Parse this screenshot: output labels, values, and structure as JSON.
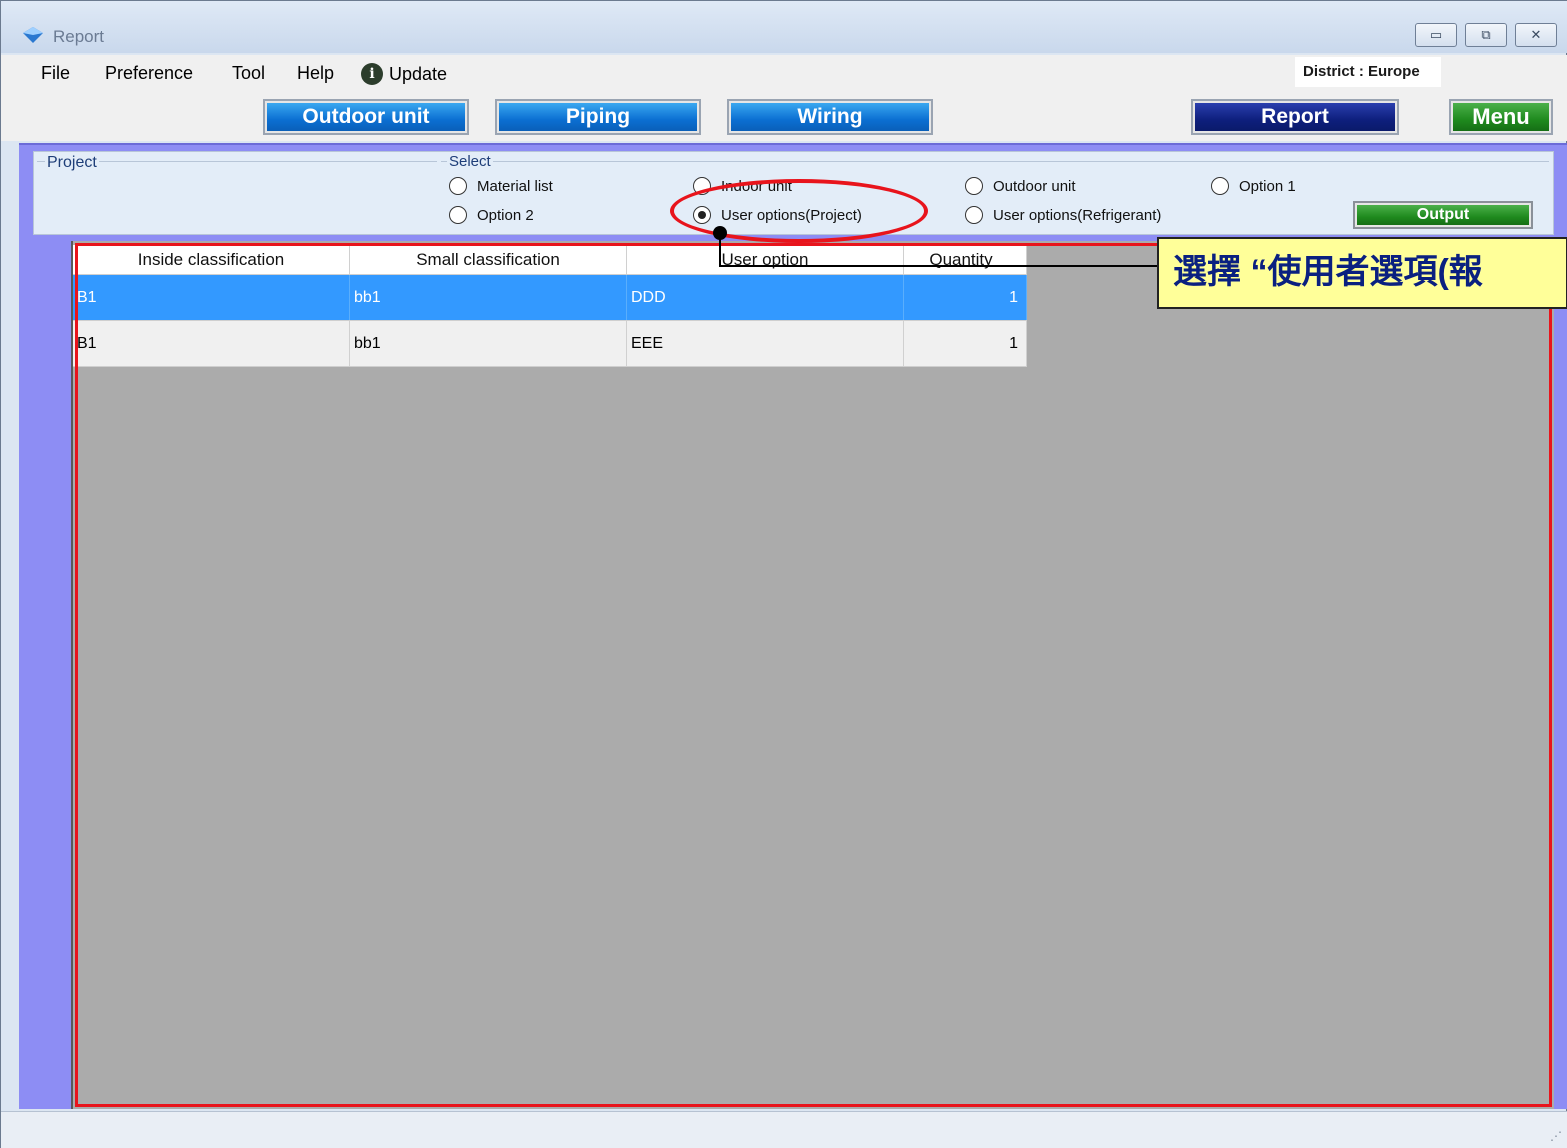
{
  "window": {
    "title": "Report",
    "controls": {
      "minimize": "▭",
      "maximize": "⧉",
      "close": "✕"
    }
  },
  "menubar": {
    "items": [
      "File",
      "Preference",
      "Tool",
      "Help"
    ],
    "update_label": "Update",
    "district": "District : Europe"
  },
  "nav": {
    "outdoor_unit": "Outdoor unit",
    "piping": "Piping",
    "wiring": "Wiring",
    "report": "Report",
    "menu": "Menu"
  },
  "project_panel": {
    "project_legend": "Project",
    "select_legend": "Select",
    "options": [
      {
        "label": "Material list",
        "selected": false
      },
      {
        "label": "Indoor unit",
        "selected": false
      },
      {
        "label": "Outdoor unit",
        "selected": false
      },
      {
        "label": "Option 1",
        "selected": false
      },
      {
        "label": "Option 2",
        "selected": false
      },
      {
        "label": "User options(Project)",
        "selected": true
      },
      {
        "label": "User options(Refrigerant)",
        "selected": false
      }
    ],
    "output_label": "Output"
  },
  "table": {
    "columns": [
      "Inside classification",
      "Small classification",
      "User option",
      "Quantity"
    ],
    "rows": [
      {
        "inside": "B1",
        "small": "bb1",
        "option": "DDD",
        "quantity": "1",
        "selected": true
      },
      {
        "inside": "B1",
        "small": "bb1",
        "option": "EEE",
        "quantity": "1",
        "selected": false
      }
    ]
  },
  "annotation": {
    "callout_text": "選擇 “使用者選項(報"
  },
  "colors": {
    "annotation_red": "#e8141c",
    "callout_bg": "#ffff99",
    "callout_text": "#0a2080",
    "frame_purple": "#8d8df4",
    "row_selected": "#3399ff"
  }
}
